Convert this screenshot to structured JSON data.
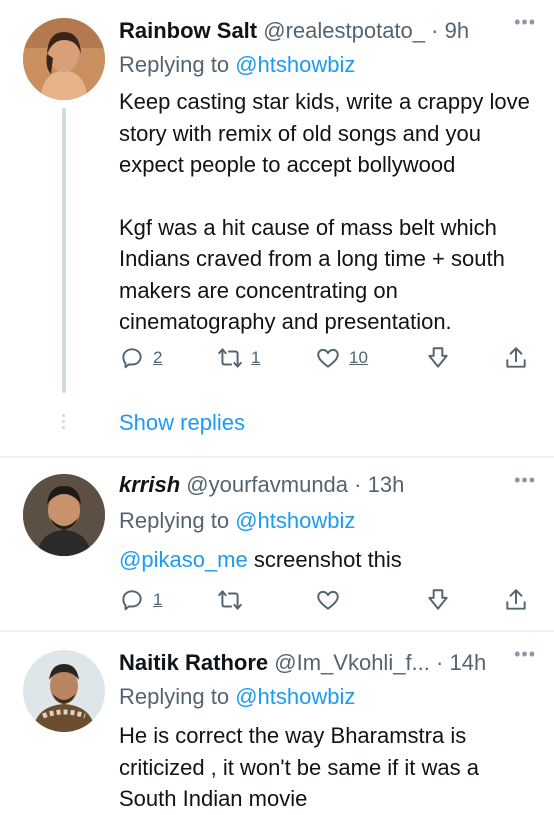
{
  "tweets": [
    {
      "name": "Rainbow Salt",
      "handle": "@realestpotato_",
      "time": "· 9h",
      "replying_prefix": "Replying to ",
      "replying_handle": "@htshowbiz",
      "text_p1": "Keep casting star kids, write a crappy love story with remix of old songs and you expect people to accept bollywood",
      "text_p2": "Kgf was a hit cause of mass belt which Indians craved from a long time  + south makers are concentrating on cinematography and presentation.",
      "replies": "2",
      "retweets": "1",
      "likes": "10",
      "more": "•••"
    },
    {
      "name": "krrish",
      "handle": "@yourfavmunda",
      "time": "· 13h",
      "replying_prefix": "Replying to ",
      "replying_handle": "@htshowbiz",
      "mention": "@pikaso_me",
      "text": " screenshot this",
      "replies": "1",
      "more": "•••"
    },
    {
      "name": "Naitik Rathore",
      "handle": "@Im_Vkohli_f...",
      "time": "· 14h",
      "replying_prefix": "Replying to ",
      "replying_handle": "@htshowbiz",
      "text": "He is correct the way  Bharamstra is criticized , it won't be same if it was a South Indian movie",
      "more": "•••"
    }
  ],
  "thread": {
    "show_replies": "Show replies"
  },
  "colors": {
    "accent": "#1d9bf0",
    "muted": "#536471",
    "divider": "#eff3f4"
  }
}
